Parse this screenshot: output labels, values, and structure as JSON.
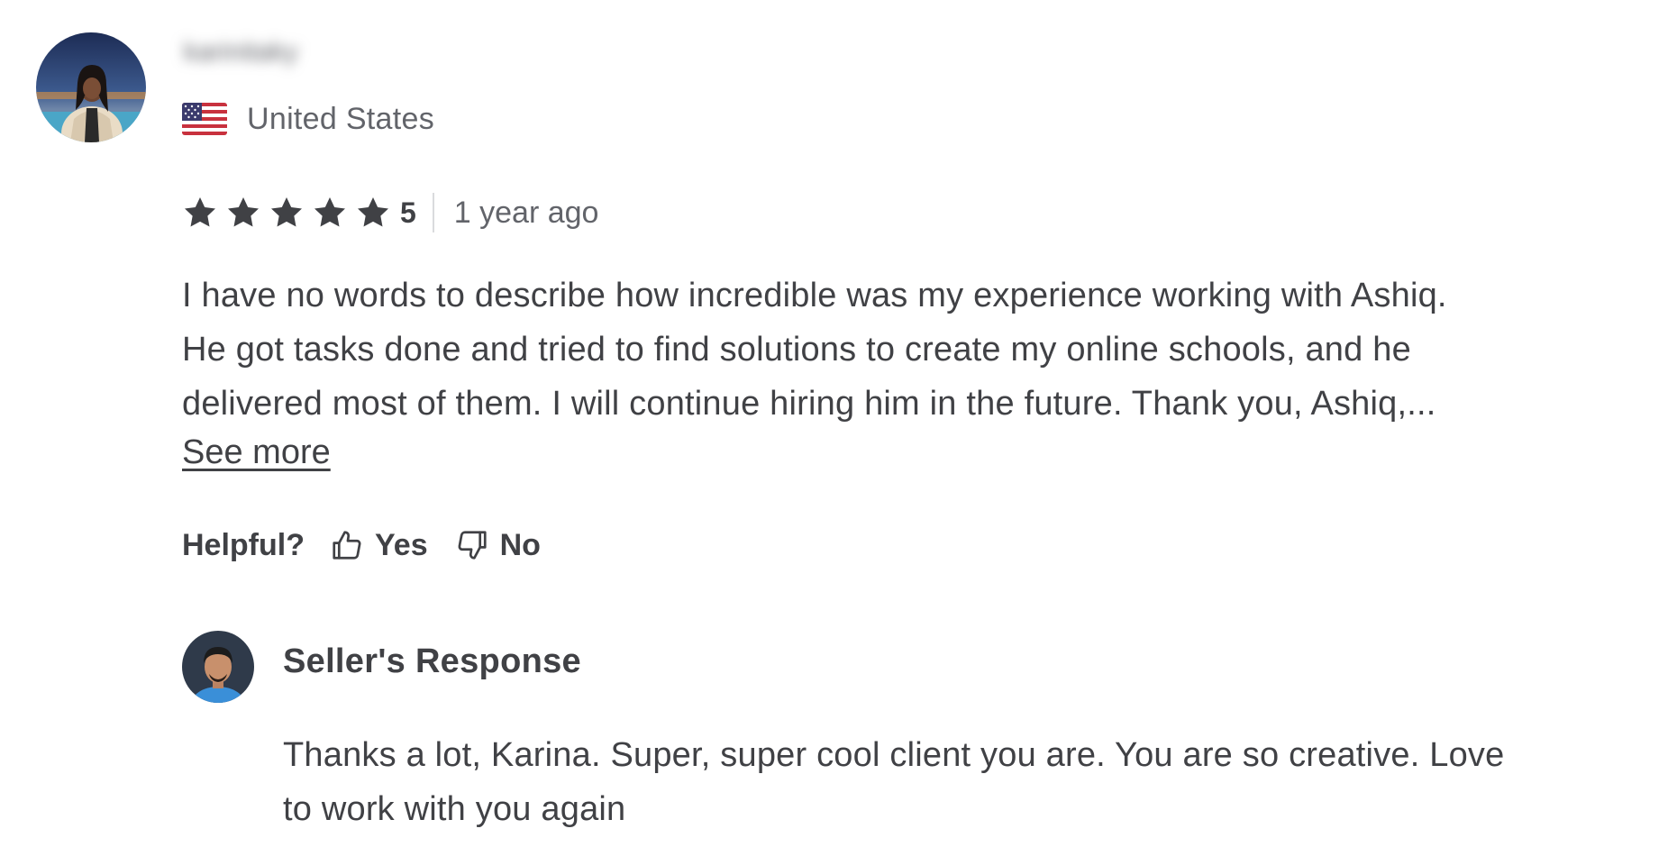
{
  "reviewer": {
    "username": "karinitaky",
    "avatar_alt": "reviewer-photo",
    "country": "United States",
    "flag": "us-flag-icon"
  },
  "rating": {
    "stars": 5,
    "score_label": "5",
    "time_ago": "1 year ago",
    "star_color": "#404145"
  },
  "review": {
    "lines": [
      "I have no words to describe how incredible was my experience working with Ashiq.",
      "He got tasks done and tried to find solutions to create my online schools, and he",
      "delivered most of them. I will continue hiring him in the future. Thank you, Ashiq,..."
    ],
    "see_more_label": "See more"
  },
  "helpful": {
    "label": "Helpful?",
    "yes_label": "Yes",
    "no_label": "No"
  },
  "seller_response": {
    "title": "Seller's Response",
    "lines": [
      "Thanks a lot, Karina. Super, super cool client you are. You are so creative. Love",
      "to work with you again"
    ]
  },
  "colors": {
    "text_primary": "#404145",
    "text_secondary": "#62646a",
    "divider": "#dadbdd"
  }
}
